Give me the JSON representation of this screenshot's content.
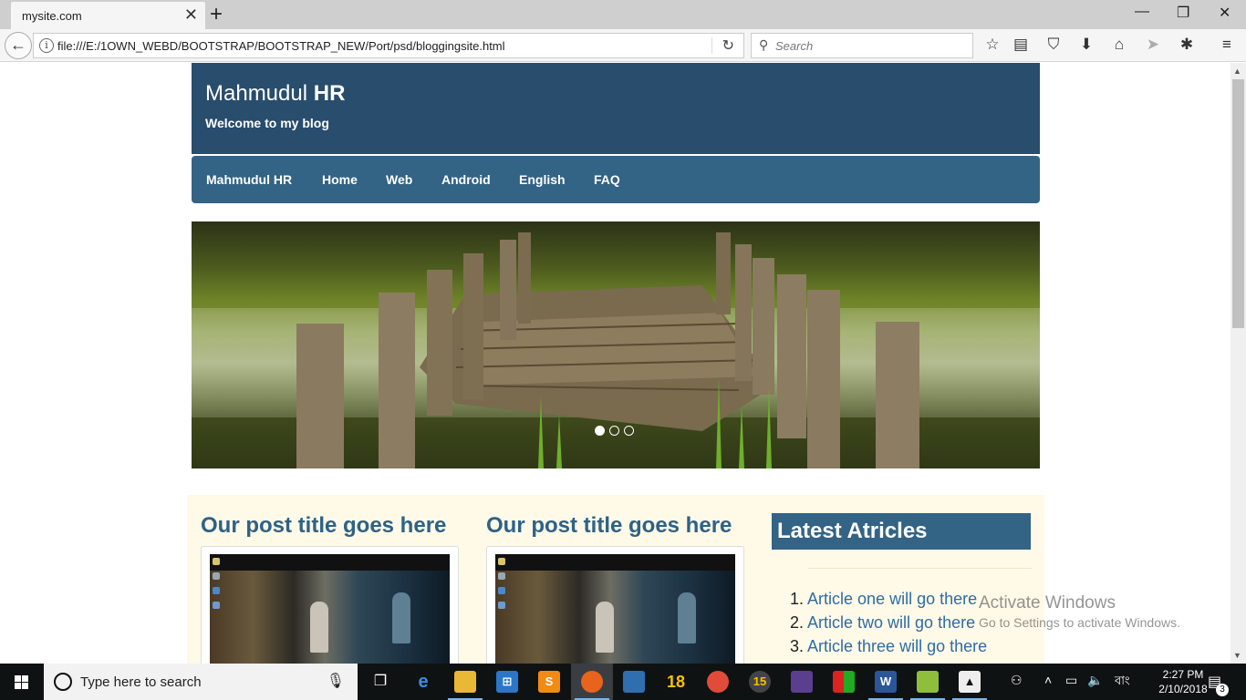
{
  "browser": {
    "tab_title": "mysite.com",
    "url": "file:///E:/1OWN_WEBD/BOOTSTRAP/BOOTSTRAP_NEW/Port/psd/bloggingsite.html",
    "search_placeholder": "Search"
  },
  "site": {
    "title_prefix": "Mahmudul ",
    "title_bold": "HR",
    "tagline": "Welcome to my blog",
    "nav": [
      "Mahmudul HR",
      "Home",
      "Web",
      "Android",
      "English",
      "FAQ"
    ],
    "carousel": {
      "slide_count": 3,
      "active_index": 0
    },
    "posts": [
      {
        "title": "Our post title goes here"
      },
      {
        "title": "Our post title goes here"
      }
    ],
    "sidebar": {
      "heading": "Latest Atricles",
      "articles": [
        {
          "num": "1.",
          "title": "Article one will go there"
        },
        {
          "num": "2.",
          "title": "Article two will go there"
        },
        {
          "num": "3.",
          "title": "Article three will go there"
        }
      ]
    }
  },
  "watermark": {
    "line1": "Activate Windows",
    "line2": "Go to Settings to activate Windows."
  },
  "taskbar": {
    "search_placeholder": "Type here to search",
    "time": "2:27 PM",
    "date": "2/10/2018",
    "language": "বাং",
    "notification_count": "3",
    "app_labels": {
      "app_15": "15",
      "app_18": "18"
    }
  },
  "colors": {
    "header_bg": "#284d6d",
    "nav_bg": "#336385",
    "post_title": "#2d6287",
    "link": "#2e6da4",
    "content_bg": "#fff9e8"
  }
}
